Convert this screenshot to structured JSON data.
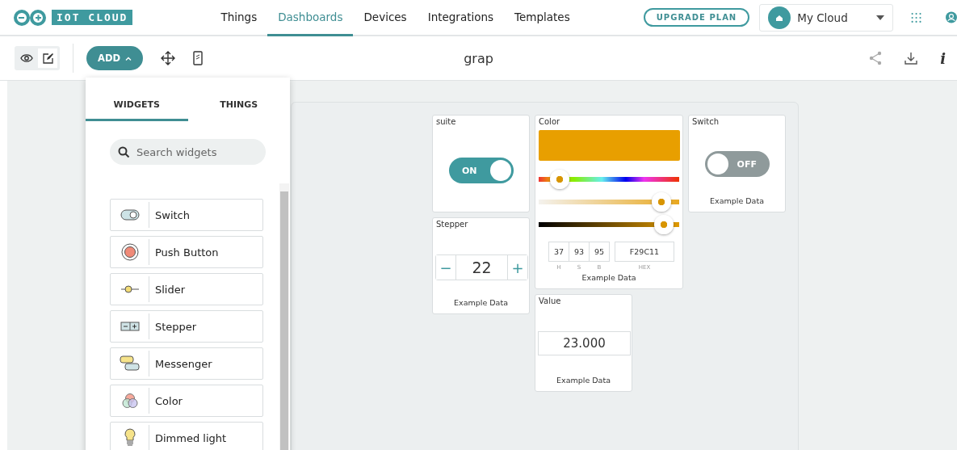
{
  "logo": {
    "text": "IOT CLOUD"
  },
  "nav": [
    {
      "label": "Things",
      "selected": false
    },
    {
      "label": "Dashboards",
      "selected": true
    },
    {
      "label": "Devices",
      "selected": false
    },
    {
      "label": "Integrations",
      "selected": false
    },
    {
      "label": "Templates",
      "selected": false
    }
  ],
  "upgrade_button": "UPGRADE PLAN",
  "space_selector": {
    "value": "My Cloud"
  },
  "toolbar": {
    "mode": [
      {
        "kind": "view",
        "selected": false
      },
      {
        "kind": "edit",
        "selected": true
      }
    ],
    "add_button": "ADD",
    "title": "grap",
    "info": "i"
  },
  "widgets_panel": {
    "tabs": [
      {
        "label": "WIDGETS",
        "selected": true
      },
      {
        "label": "THINGS",
        "selected": false
      }
    ],
    "search": {
      "placeholder": "Search widgets"
    },
    "items": [
      {
        "kind": "switch",
        "label": "Switch"
      },
      {
        "kind": "push",
        "label": "Push Button"
      },
      {
        "kind": "slider",
        "label": "Slider"
      },
      {
        "kind": "stepper",
        "label": "Stepper"
      },
      {
        "kind": "messenger",
        "label": "Messenger"
      },
      {
        "kind": "color",
        "label": "Color"
      },
      {
        "kind": "light",
        "label": "Dimmed light"
      }
    ]
  },
  "dashboard": [
    {
      "kind": "switch",
      "title": "suite",
      "on": true,
      "state_label": "ON"
    },
    {
      "kind": "stepper",
      "title": "Stepper",
      "value": "22",
      "minus": "−",
      "plus": "+",
      "caption": "Example Data"
    },
    {
      "kind": "color",
      "title": "Color",
      "color": "#e89f00",
      "hue": {
        "level": 0.09
      },
      "saturation": {
        "level": 0.93
      },
      "brightness": {
        "level": 0.95
      },
      "fields": [
        {
          "value": "37",
          "label": "H"
        },
        {
          "value": "93",
          "label": "S"
        },
        {
          "value": "95",
          "label": "B"
        }
      ],
      "hex": {
        "value": "F29C11",
        "label": "HEX"
      },
      "caption": "Example Data"
    },
    {
      "kind": "switch",
      "title": "Switch",
      "on": false,
      "state_label": "OFF",
      "caption": "Example Data"
    },
    {
      "kind": "value",
      "title": "Value",
      "value": "23.000",
      "caption": "Example Data"
    }
  ]
}
